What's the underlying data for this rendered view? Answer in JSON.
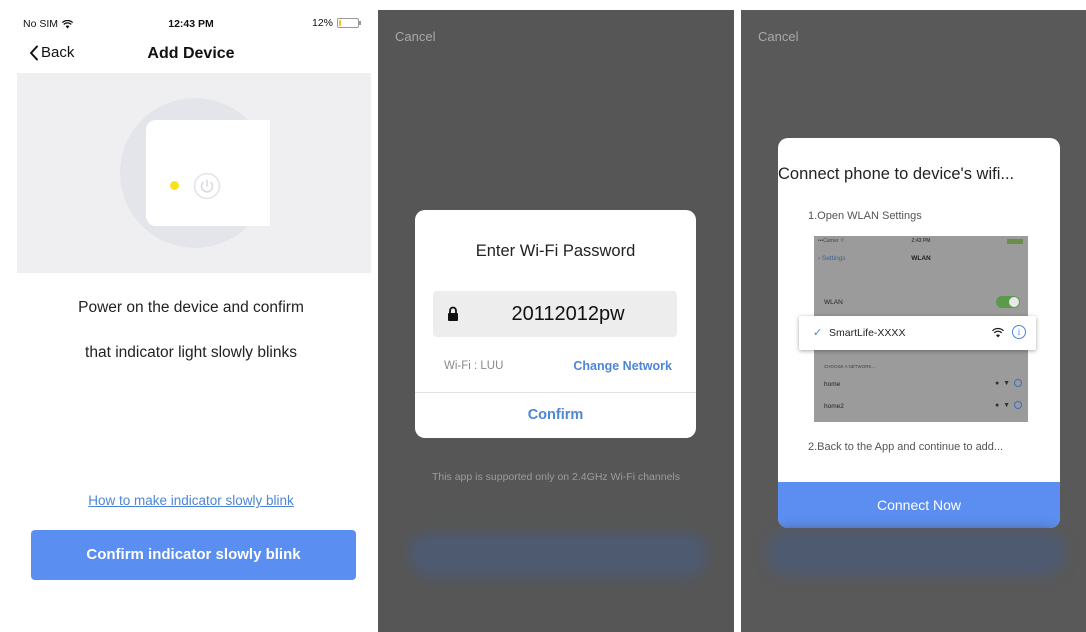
{
  "screen1": {
    "status": {
      "carrier": "No SIM",
      "time": "12:43 PM",
      "battery": "12%",
      "battery_level": 0.12
    },
    "nav": {
      "back_label": "Back",
      "title": "Add Device"
    },
    "instructions": [
      "Power on the device and confirm",
      "that indicator light slowly blinks"
    ],
    "help_link": "How to make indicator slowly blink",
    "confirm_button": "Confirm indicator slowly blink"
  },
  "screen2": {
    "cancel": "Cancel",
    "dialog": {
      "title": "Enter Wi-Fi Password",
      "password": "20112012pw",
      "wifi_label": "Wi-Fi : LUU",
      "change_network": "Change Network",
      "confirm": "Confirm"
    },
    "note": "This app is supported only on 2.4GHz Wi-Fi channels"
  },
  "screen3": {
    "cancel": "Cancel",
    "card": {
      "title": "Connect phone to device's wifi...",
      "step1": "1.Open WLAN Settings",
      "step2": "2.Back to the App and continue to add...",
      "settings_shot": {
        "carrier": "•••Carrier ⌔",
        "time": "2:43 PM",
        "back": "Settings",
        "title": "WLAN",
        "wlan_label": "WLAN",
        "section": "CHOOSE A NETWORK...",
        "networks": [
          "home",
          "home2"
        ]
      },
      "ssid": "SmartLife-XXXX",
      "connect_button": "Connect Now"
    }
  },
  "colors": {
    "accent": "#4d86d6",
    "button": "#5a8ef0",
    "led": "#f6e320",
    "overlay": "#565656"
  }
}
